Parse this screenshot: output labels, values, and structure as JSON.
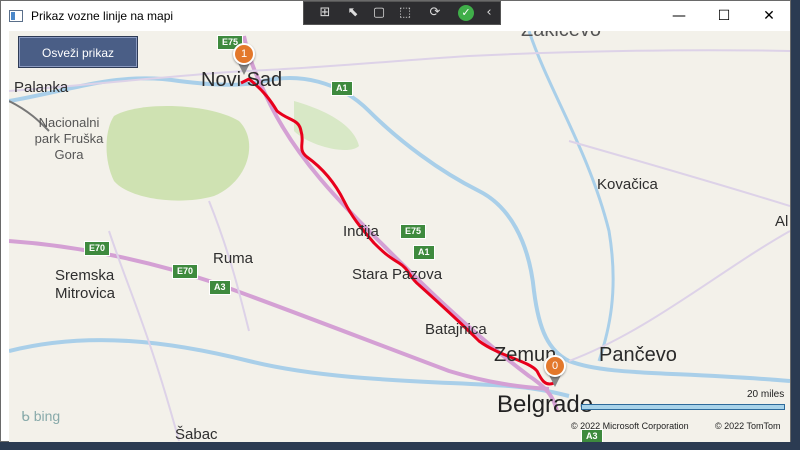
{
  "window": {
    "title": "Prikaz vozne linije na mapi",
    "minimize_icon": "minimize-icon",
    "maximize_icon": "maximize-icon",
    "close_icon": "close-icon"
  },
  "debug_toolbar": {
    "icons": [
      "live-visual-tree-icon",
      "select-element-icon",
      "display-layout-adorners-icon",
      "track-focus-icon",
      "hot-reload-icon",
      "check-icon",
      "collapse-chevron-icon"
    ]
  },
  "toolbar": {
    "refresh_label": "Osveži prikaz"
  },
  "map": {
    "labels": {
      "zakicevo": "Zakićevo",
      "novi_sad": "Novi Sad",
      "palanka": "Palanka",
      "park": "Nacionalni park Fruška Gora",
      "kovacica": "Kovačica",
      "indjija": "Inđija",
      "ruma": "Ruma",
      "sremska_mitrovica": "Sremska Mitrovica",
      "stara_pazova": "Stara Pazova",
      "batajnica": "Batajnica",
      "zemun": "Zemun",
      "pancevo": "Pančevo",
      "belgrade": "Belgrade",
      "sabac": "Šabac",
      "alibunar": "Al"
    },
    "shields": {
      "e75_top": "E75",
      "a1_top": "A1",
      "e75_mid": "E75",
      "a1_mid": "A1",
      "e70_left": "E70",
      "e70_mid": "E70",
      "a3": "A3",
      "a3_bottom": "A3"
    },
    "markers": {
      "start": "0",
      "end": "1"
    },
    "route_color": "#e8001c",
    "scale_label": "20 miles",
    "copyright_ms": "© 2022 Microsoft Corporation",
    "copyright_tt": "© 2022 TomTom",
    "bing_label": "bing"
  }
}
